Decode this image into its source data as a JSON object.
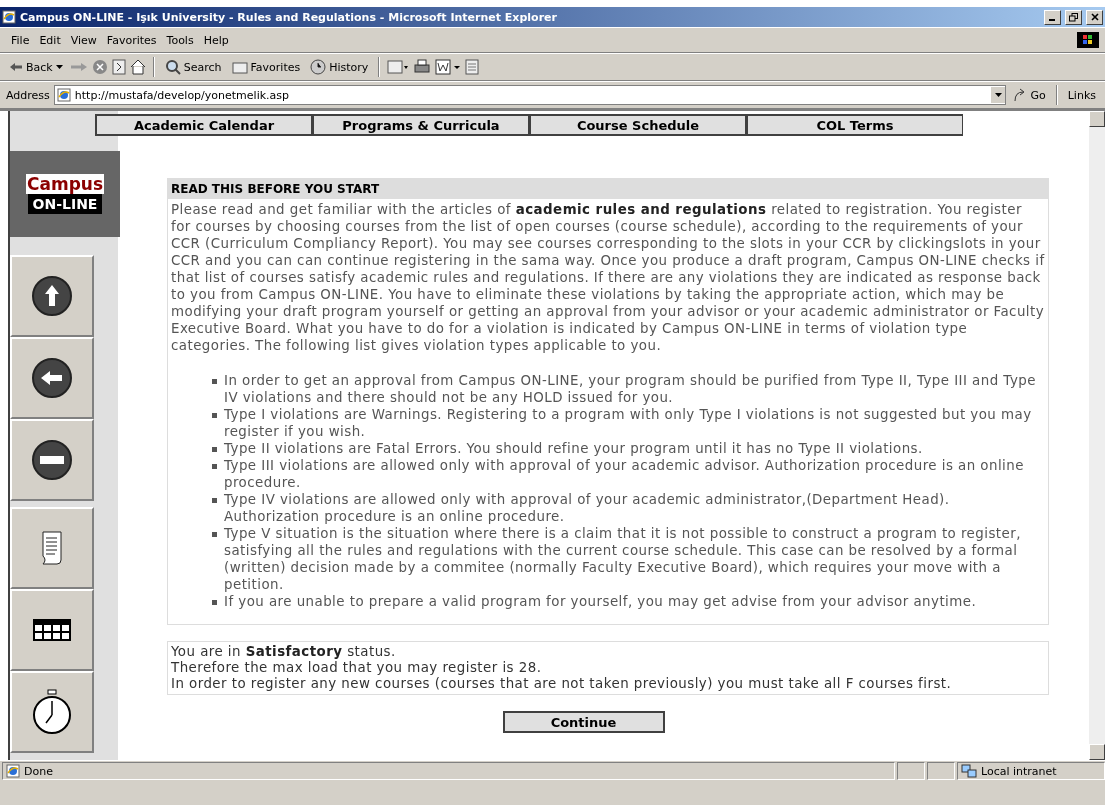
{
  "window": {
    "title": "Campus ON-LINE - Işık University - Rules and Regulations - Microsoft Internet Explorer"
  },
  "menu": [
    "File",
    "Edit",
    "View",
    "Favorites",
    "Tools",
    "Help"
  ],
  "toolbar": {
    "back": "Back",
    "search": "Search",
    "favorites": "Favorites",
    "history": "History"
  },
  "address": {
    "label": "Address",
    "url": "http://mustafa/develop/yonetmelik.asp",
    "go": "Go",
    "links": "Links"
  },
  "nav_tabs": [
    "Academic Calendar",
    "Programs & Curricula",
    "Course Schedule",
    "COL Terms"
  ],
  "logo": {
    "top": "Campus",
    "bottom": "ON-LINE"
  },
  "article": {
    "heading": "READ THIS BEFORE YOU START",
    "intro": "Please read and get familiar with the articles of **academic rules and regulations** related to registration. You register for courses by choosing courses from the list of open courses (course schedule), according to the requirements of your CCR (Curriculum Compliancy Report). You may see courses corresponding to the slots in your CCR by clickingslots in your CCR and you can can continue registering in the sama way. Once you produce a draft program, Campus ON-LINE checks if that list of courses satisfy academic rules and regulations. If there are any violations they are indicated as response back to you from Campus ON-LINE. You have to eliminate these violations by taking the appropriate action, which may be modifying your draft program yourself or getting an approval from your advisor or your academic administrator or Faculty Executive Board. What you have to do for a violation is indicated by Campus ON-LINE in terms of violation type categories. The following list gives violation types applicable to you.",
    "bullets": [
      "In order to get an approval from Campus ON-LINE, your program should be purified from Type II, Type III and Type IV violations and there should not be any HOLD issued for you.",
      "Type I violations are Warnings. Registering to a program with only Type I violations is not suggested but you may register if you wish.",
      "Type II violations are Fatal Errors. You should refine your program until it has no Type II violations.",
      "Type III violations are allowed only with approval of your academic advisor. Authorization procedure is an online procedure.",
      "Type IV violations are allowed only with approval of your academic administrator,(Department Head). Authorization procedure is an online procedure.",
      "Type V situation is the situation where there is a claim that it is not possible to construct a program to register, satisfying all the rules and regulations with the current course schedule. This case can be resolved by a formal (written) decision made by a commitee (normally Faculty Executive Board), which requires your move with a petition.",
      "If you are unable to prepare a valid program for yourself, you may get advise from your advisor anytime."
    ]
  },
  "status_box": [
    "You are in **Satisfactory** status.",
    "Therefore the max load that you may register is 28.",
    "In order to register any new courses (courses that are not taken previously) you must take all F courses first."
  ],
  "continue_button": "Continue",
  "status_bar": {
    "text": "Done",
    "zone": "Local intranet"
  }
}
